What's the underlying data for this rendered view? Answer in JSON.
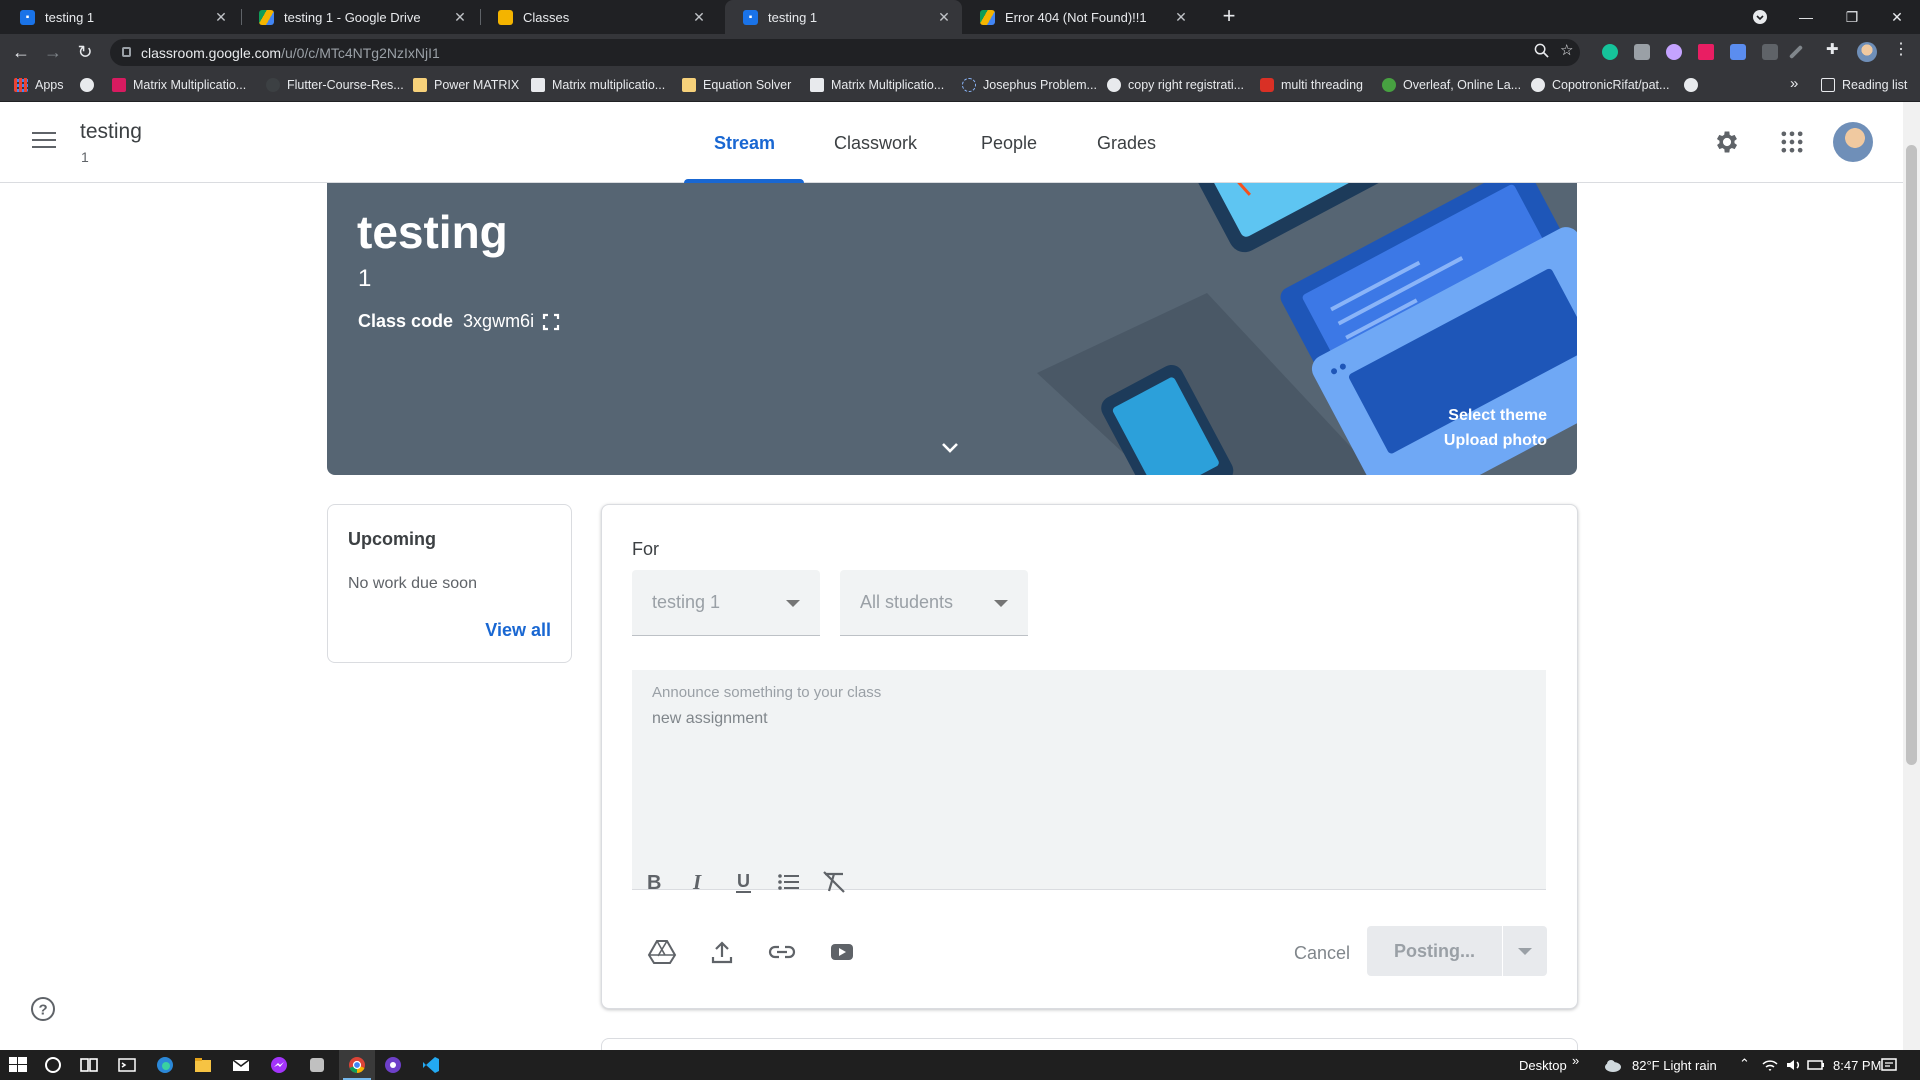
{
  "browser": {
    "tabs": [
      {
        "title": "testing 1",
        "favicon": "classroom-icon",
        "color": "#1a73e8",
        "active": false
      },
      {
        "title": "testing 1 - Google Drive",
        "favicon": "drive-icon",
        "color": "#0f9d58",
        "active": false
      },
      {
        "title": "Classes",
        "favicon": "classroom-icon",
        "color": "#f4b400",
        "active": false
      },
      {
        "title": "testing 1",
        "favicon": "classroom-icon",
        "color": "#1a73e8",
        "active": true
      },
      {
        "title": "Error 404 (Not Found)!!1",
        "favicon": "drive-icon",
        "color": "#0f9d58",
        "active": false
      }
    ],
    "address": {
      "domain": "classroom.google.com",
      "path": "/u/0/c/MTc4NTg2NzIxNjI1"
    },
    "bookmarks": {
      "apps_label": "Apps",
      "items": [
        "Matrix Multiplicatio...",
        "Flutter-Course-Res...",
        "Power MATRIX",
        "Matrix multiplicatio...",
        "Equation Solver",
        "Matrix Multiplicatio...",
        "Josephus Problem...",
        "copy right registrati...",
        "multi threading",
        "Overleaf, Online La...",
        "CopotronicRifat/pat..."
      ],
      "overflow": "»",
      "reading_list": "Reading list"
    }
  },
  "header": {
    "class_name": "testing",
    "section": "1",
    "tabs": [
      "Stream",
      "Classwork",
      "People",
      "Grades"
    ],
    "active_tab": "Stream"
  },
  "banner": {
    "title": "testing",
    "section": "1",
    "class_code_label": "Class code",
    "class_code": "3xgwm6i",
    "select_theme": "Select theme",
    "upload_photo": "Upload photo"
  },
  "upcoming": {
    "title": "Upcoming",
    "text": "No work due soon",
    "view_all": "View all"
  },
  "composer": {
    "for_label": "For",
    "class_select": "testing 1",
    "students_select": "All students",
    "placeholder": "Announce something to your class",
    "value": "new assignment",
    "cancel_label": "Cancel",
    "post_label": "Posting..."
  },
  "taskbar": {
    "desktop_label": "Desktop",
    "weather": "82°F  Light rain",
    "time": "8:47 PM"
  },
  "colors": {
    "accent": "#1967d2",
    "banner": "#566573"
  }
}
